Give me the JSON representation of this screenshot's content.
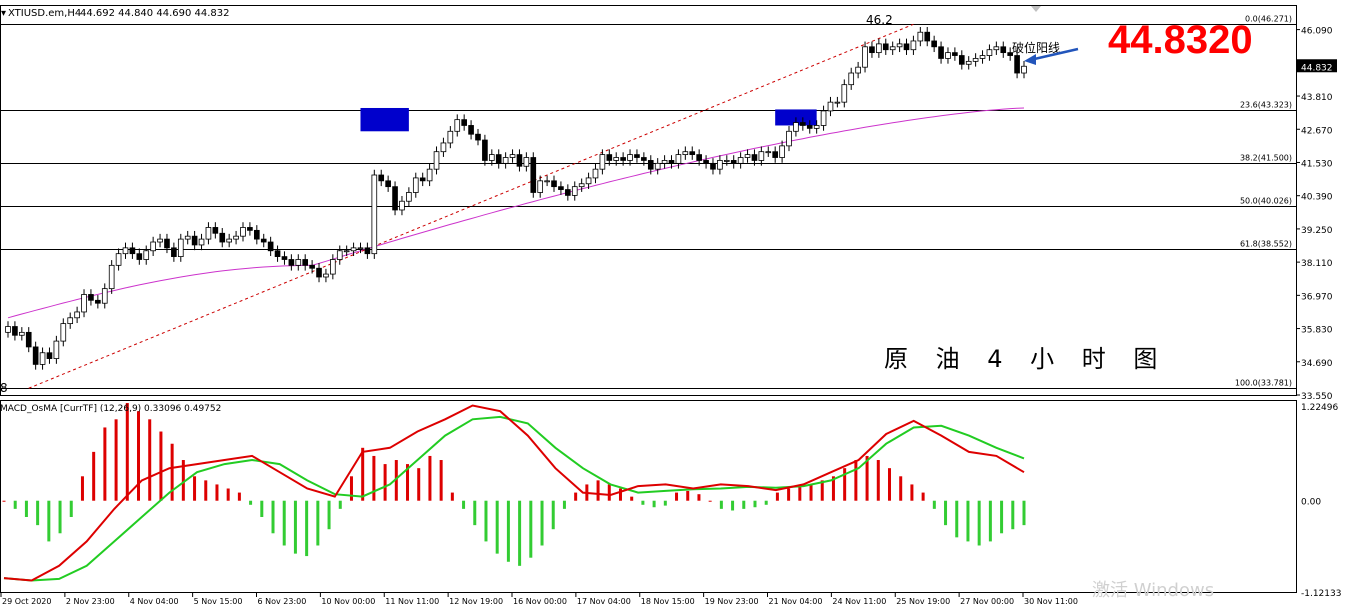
{
  "header": {
    "symbol": "XTIUSD.em,H4",
    "ohlc": "44.692 44.840 44.690 44.832"
  },
  "big_price": "44.8320",
  "current_price_tag": "44.832",
  "title_cn": "原 油 4 小 时 图",
  "annotation_break": "破位阳线",
  "peak_label": "46.2",
  "low_label": "8",
  "macd_label": "MACD_OsMA [CurrTF] (12,26,9) 0.33096 0.49752",
  "windows_watermark": "激活 Windows",
  "colors": {
    "up_candle": "#ffffff",
    "down_candle": "#000000",
    "ma_line": "#cc33cc",
    "trend_line": "#cc0000",
    "price_tag_bg": "#000000",
    "big_price": "#ff0000",
    "rect_fill": "#0000cc",
    "macd_pos": "#dd0000",
    "macd_neg": "#33cc33",
    "signal_line": "#22cc22",
    "macd_line": "#dd0000",
    "arrow": "#2255bb"
  },
  "chart_data": [
    {
      "type": "candlestick",
      "ylim": [
        33.55,
        46.9
      ],
      "price_axis_ticks": [
        46.09,
        44.832,
        43.81,
        42.67,
        41.53,
        40.39,
        39.25,
        38.11,
        36.97,
        35.83,
        34.69,
        33.55
      ],
      "price_axis_labels": [
        "46.090",
        "44.832",
        "43.810",
        "42.670",
        "41.530",
        "40.390",
        "39.250",
        "38.110",
        "36.970",
        "35.830",
        "34.690",
        "33.550"
      ],
      "x_labels": [
        "29 Oct 2020",
        "2 Nov 23:00",
        "4 Nov 04:00",
        "5 Nov 15:00",
        "6 Nov 23:00",
        "10 Nov 00:00",
        "11 Nov 11:00",
        "12 Nov 19:00",
        "16 Nov 00:00",
        "17 Nov 04:00",
        "18 Nov 15:00",
        "19 Nov 23:00",
        "21 Nov 04:00",
        "24 Nov 11:00",
        "25 Nov 19:00",
        "27 Nov 00:00",
        "30 Nov 11:00"
      ],
      "fib_levels": [
        {
          "label": "0.0(46.271)",
          "value": 46.271
        },
        {
          "label": "23.6(43.323)",
          "value": 43.323
        },
        {
          "label": "38.2(41.500)",
          "value": 41.5
        },
        {
          "label": "50.0(40.026)",
          "value": 40.026
        },
        {
          "label": "61.8(38.552)",
          "value": 38.552
        },
        {
          "label": "100.0(33.781)",
          "value": 33.781
        }
      ],
      "closes": [
        35.9,
        35.6,
        35.7,
        35.2,
        34.6,
        35.0,
        34.8,
        35.4,
        36.0,
        36.2,
        36.4,
        37.0,
        36.8,
        36.7,
        37.2,
        38.0,
        38.4,
        38.6,
        38.4,
        38.2,
        38.5,
        38.8,
        38.9,
        38.6,
        38.3,
        38.9,
        39.0,
        38.7,
        38.9,
        39.3,
        39.1,
        38.8,
        38.9,
        39.0,
        39.3,
        39.2,
        38.9,
        38.8,
        38.5,
        38.3,
        38.2,
        38.0,
        38.2,
        38.0,
        37.9,
        37.6,
        37.7,
        38.2,
        38.5,
        38.5,
        38.6,
        38.6,
        38.4,
        41.1,
        40.9,
        40.7,
        39.9,
        40.2,
        40.5,
        41.0,
        40.9,
        41.3,
        41.9,
        42.2,
        42.6,
        43.0,
        42.8,
        42.5,
        42.3,
        41.6,
        41.8,
        41.5,
        41.7,
        41.8,
        41.4,
        41.7,
        40.5,
        40.9,
        40.9,
        40.7,
        40.6,
        40.4,
        40.7,
        40.8,
        41.0,
        41.3,
        41.8,
        41.6,
        41.7,
        41.6,
        41.8,
        41.7,
        41.6,
        41.3,
        41.5,
        41.6,
        41.5,
        41.8,
        41.9,
        41.8,
        41.6,
        41.5,
        41.3,
        41.6,
        41.6,
        41.5,
        41.7,
        41.8,
        41.6,
        41.9,
        41.9,
        41.7,
        42.1,
        42.6,
        42.9,
        42.8,
        42.7,
        42.8,
        43.3,
        43.6,
        43.6,
        44.2,
        44.6,
        44.8,
        45.5,
        45.3,
        45.6,
        45.4,
        45.5,
        45.6,
        45.4,
        45.7,
        46.0,
        45.7,
        45.5,
        45.1,
        45.3,
        45.2,
        44.9,
        45.0,
        45.1,
        45.2,
        45.4,
        45.5,
        45.3,
        45.2,
        44.6,
        44.832
      ],
      "ma": {
        "start": 36.2,
        "low": 38.0,
        "end": 43.4
      },
      "resistance_boxes": [
        {
          "x_from_candle": 51,
          "x_to_candle": 58,
          "y_from": 42.6,
          "y_to": 43.4
        },
        {
          "x_from_candle": 111,
          "x_to_candle": 117,
          "y_from": 42.8,
          "y_to": 43.35
        }
      ],
      "trendline": {
        "from": {
          "candle": 3,
          "price": 33.781
        },
        "to": {
          "candle": 131,
          "price": 46.271
        }
      }
    },
    {
      "type": "bar",
      "name": "MACD_OsMA",
      "ylim": [
        -1.12133,
        1.22496
      ],
      "axis_labels": [
        "1.22496",
        "0.00",
        "-1.12133"
      ],
      "histogram": [
        0.0,
        -0.1,
        -0.2,
        -0.3,
        -0.5,
        -0.4,
        -0.2,
        0.3,
        0.6,
        0.9,
        1.0,
        1.2,
        1.1,
        1.0,
        0.85,
        0.7,
        0.5,
        0.3,
        0.25,
        0.2,
        0.15,
        0.1,
        -0.05,
        -0.2,
        -0.4,
        -0.55,
        -0.65,
        -0.68,
        -0.55,
        -0.35,
        -0.1,
        0.3,
        0.65,
        0.55,
        0.45,
        0.5,
        0.45,
        0.4,
        0.55,
        0.5,
        0.1,
        -0.1,
        -0.3,
        -0.5,
        -0.65,
        -0.75,
        -0.8,
        -0.7,
        -0.55,
        -0.35,
        -0.1,
        0.1,
        0.2,
        0.25,
        0.2,
        0.15,
        0.05,
        -0.05,
        -0.08,
        -0.06,
        0.1,
        0.12,
        0.08,
        0.0,
        -0.1,
        -0.12,
        -0.1,
        -0.08,
        -0.05,
        0.1,
        0.15,
        0.18,
        0.2,
        0.25,
        0.3,
        0.4,
        0.5,
        0.55,
        0.5,
        0.4,
        0.3,
        0.2,
        0.1,
        -0.1,
        -0.3,
        -0.45,
        -0.5,
        -0.55,
        -0.5,
        -0.4,
        -0.35,
        -0.3
      ],
      "signal_line": [
        -0.95,
        -0.98,
        -0.96,
        -0.8,
        -0.5,
        -0.2,
        0.1,
        0.35,
        0.45,
        0.5,
        0.45,
        0.25,
        0.08,
        0.05,
        0.2,
        0.5,
        0.8,
        1.0,
        1.03,
        0.95,
        0.65,
        0.4,
        0.2,
        0.1,
        0.12,
        0.14,
        0.15,
        0.17,
        0.16,
        0.18,
        0.25,
        0.4,
        0.7,
        0.9,
        0.92,
        0.8,
        0.65,
        0.52
      ],
      "macd_line": [
        -0.95,
        -0.98,
        -0.8,
        -0.5,
        -0.1,
        0.25,
        0.4,
        0.45,
        0.5,
        0.55,
        0.35,
        0.15,
        0.05,
        0.6,
        0.65,
        0.85,
        1.0,
        1.17,
        1.1,
        0.8,
        0.4,
        0.1,
        0.07,
        0.18,
        0.2,
        0.15,
        0.2,
        0.18,
        0.13,
        0.2,
        0.35,
        0.5,
        0.82,
        0.98,
        0.8,
        0.6,
        0.55,
        0.35
      ]
    }
  ]
}
